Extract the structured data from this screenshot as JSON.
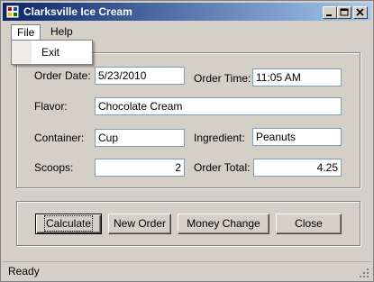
{
  "window": {
    "title": "Clarksville Ice Cream"
  },
  "menu": {
    "file": "File",
    "help": "Help",
    "file_items": [
      "Exit"
    ]
  },
  "form": {
    "order_date_label": "Order Date:",
    "order_date": "5/23/2010",
    "order_time_label": "Order Time:",
    "order_time": "11:05 AM",
    "flavor_label": "Flavor:",
    "flavor": "Chocolate Cream",
    "container_label": "Container:",
    "container": "Cup",
    "ingredient_label": "Ingredient:",
    "ingredient": "Peanuts",
    "scoops_label": "Scoops:",
    "scoops": "2",
    "order_total_label": "Order Total:",
    "order_total": "4.25"
  },
  "buttons": {
    "calculate": "Calculate",
    "new_order": "New Order",
    "money_change": "Money Change",
    "close": "Close"
  },
  "status": {
    "text": "Ready"
  },
  "icons": {
    "app": "app-icon",
    "minimize": "minimize-icon",
    "maximize": "maximize-icon",
    "close": "close-icon",
    "grip": "size-grip-icon"
  }
}
